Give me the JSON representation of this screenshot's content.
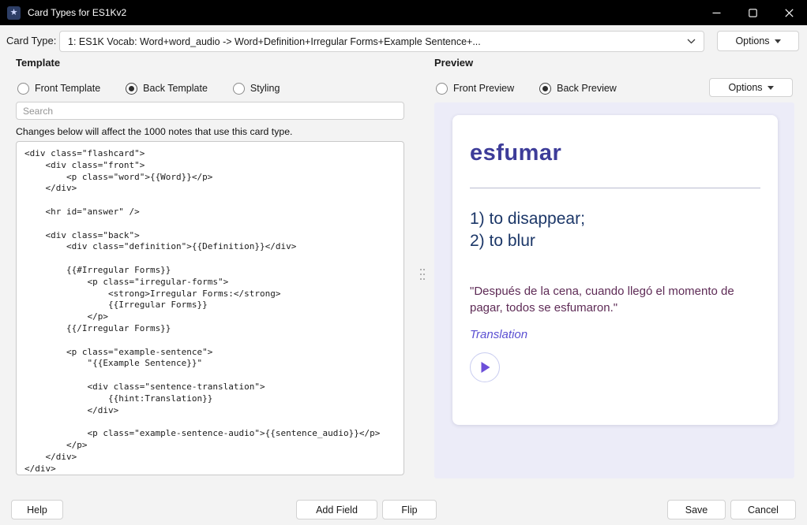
{
  "window": {
    "title": "Card Types for ES1Kv2",
    "app_icon_glyph": "★"
  },
  "card_type": {
    "label": "Card Type:",
    "value": "1: ES1K Vocab: Word+word_audio -> Word+Definition+Irregular Forms+Example Sentence+...",
    "options_label": "Options"
  },
  "template": {
    "header": "Template",
    "radios": [
      {
        "label": "Front Template",
        "selected": false
      },
      {
        "label": "Back Template",
        "selected": true
      },
      {
        "label": "Styling",
        "selected": false
      }
    ],
    "search_placeholder": "Search",
    "notice": "Changes below will affect the 1000 notes that use this card type.",
    "code": "<div class=\"flashcard\">\n    <div class=\"front\">\n        <p class=\"word\">{{Word}}</p>\n    </div>\n\n    <hr id=\"answer\" />\n\n    <div class=\"back\">\n        <div class=\"definition\">{{Definition}}</div>\n\n        {{#Irregular Forms}}\n            <p class=\"irregular-forms\">\n                <strong>Irregular Forms:</strong>\n                {{Irregular Forms}}\n            </p>\n        {{/Irregular Forms}}\n\n        <p class=\"example-sentence\">\n            \"{{Example Sentence}}\"\n\n            <div class=\"sentence-translation\">\n                {{hint:Translation}}\n            </div>\n\n            <p class=\"example-sentence-audio\">{{sentence_audio}}</p>\n        </p>\n    </div>\n</div>"
  },
  "preview": {
    "header": "Preview",
    "radios": [
      {
        "label": "Front Preview",
        "selected": false
      },
      {
        "label": "Back Preview",
        "selected": true
      }
    ],
    "options_label": "Options",
    "card": {
      "word": "esfumar",
      "definition": "1) to disappear;\n2) to blur",
      "sentence": "\"Después de la cena, cuando llegó el momento de pagar, todos se esfumaron.\"",
      "translation_link": "Translation"
    }
  },
  "footer": {
    "help": "Help",
    "add_field": "Add Field",
    "flip": "Flip",
    "save": "Save",
    "cancel": "Cancel"
  },
  "colors": {
    "word": "#3d3c99",
    "definition": "#1c3768",
    "sentence": "#5e2b56",
    "translation": "#5b50d2",
    "play": "#6c4fd9",
    "preview_bg": "#ececf8"
  }
}
